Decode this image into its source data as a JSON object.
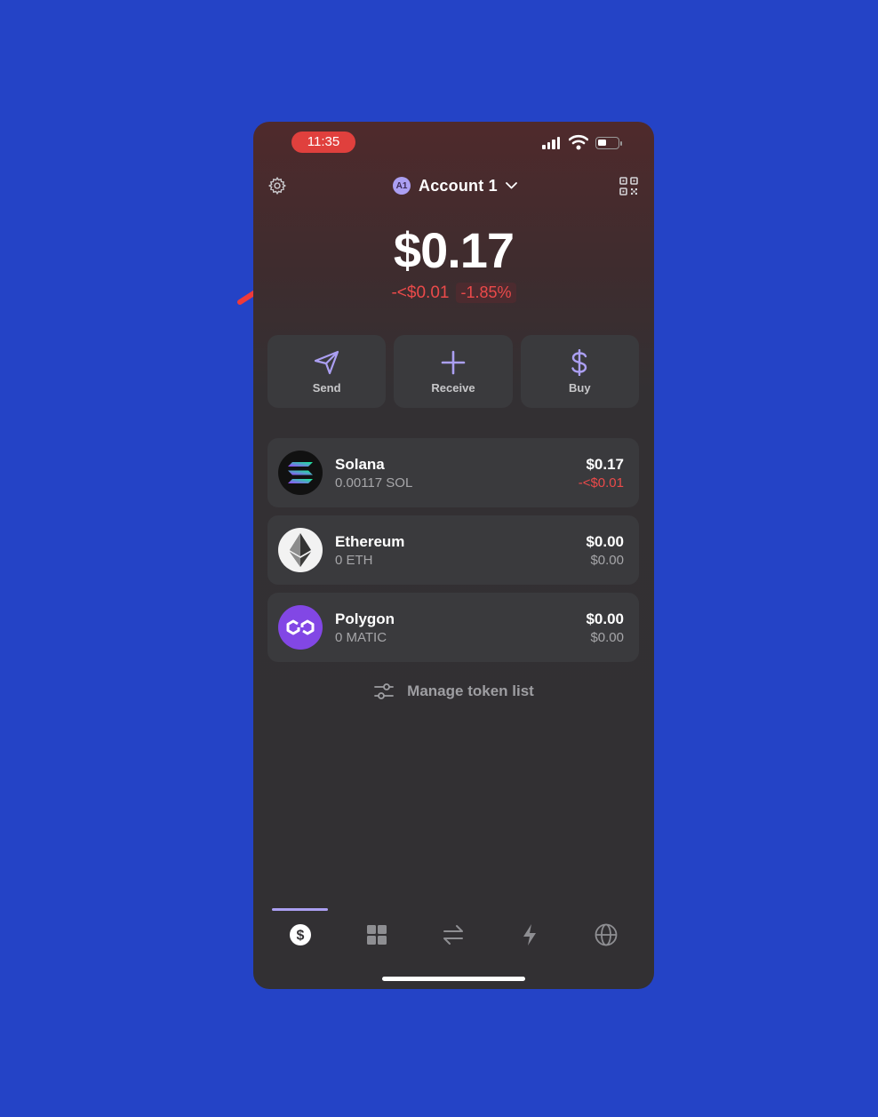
{
  "status_bar": {
    "time": "11:35"
  },
  "header": {
    "account_initials": "A1",
    "account_name": "Account 1"
  },
  "balance": {
    "total": "$0.17",
    "change_amount": "-<$0.01",
    "change_percent": "-1.85%"
  },
  "actions": [
    {
      "label": "Send",
      "icon": "send-icon"
    },
    {
      "label": "Receive",
      "icon": "plus-icon"
    },
    {
      "label": "Buy",
      "icon": "dollar-icon"
    }
  ],
  "tokens": [
    {
      "name": "Solana",
      "amount": "0.00117 SOL",
      "value": "$0.17",
      "change": "-<$0.01",
      "icon": "solana-logo-icon"
    },
    {
      "name": "Ethereum",
      "amount": "0 ETH",
      "value": "$0.00",
      "change": "$0.00",
      "icon": "ethereum-logo-icon"
    },
    {
      "name": "Polygon",
      "amount": "0 MATIC",
      "value": "$0.00",
      "change": "$0.00",
      "icon": "polygon-logo-icon"
    }
  ],
  "manage_token_list": "Manage token list",
  "tabs": [
    {
      "icon": "dollar-circle-icon",
      "active": true
    },
    {
      "icon": "grid-icon",
      "active": false
    },
    {
      "icon": "swap-arrows-icon",
      "active": false
    },
    {
      "icon": "lightning-icon",
      "active": false
    },
    {
      "icon": "globe-icon",
      "active": false
    }
  ],
  "colors": {
    "background": "#2443c6",
    "accent": "#ab9ff2",
    "negative": "#eb4a4a",
    "annotation_arrow": "#ef3a3a"
  }
}
